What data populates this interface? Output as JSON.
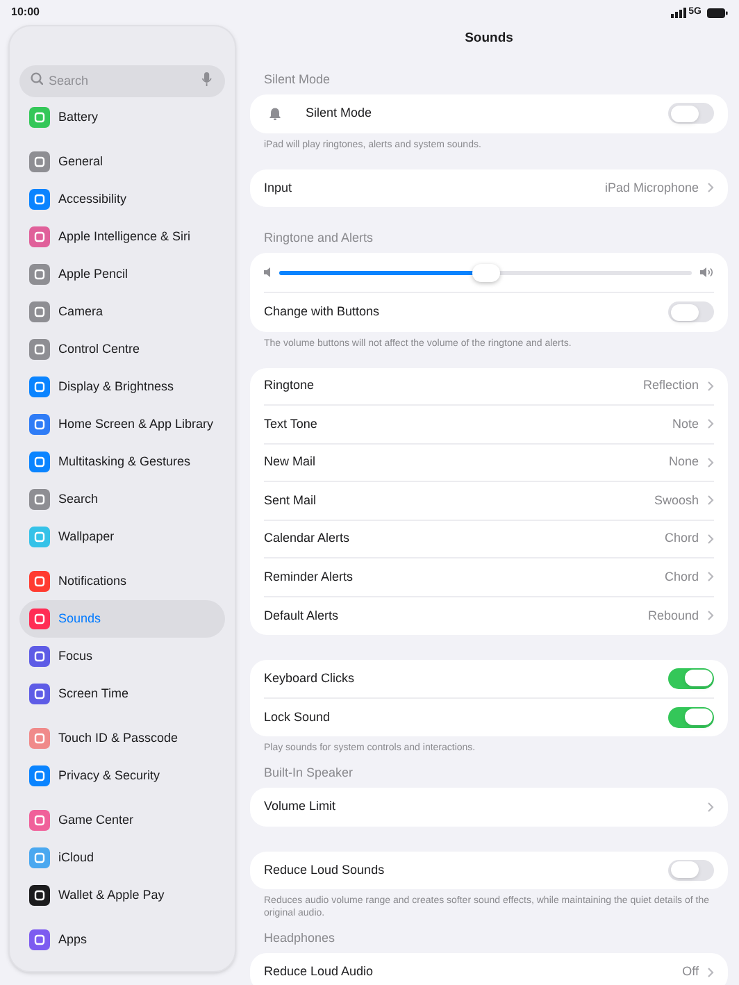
{
  "status_bar": {
    "time": "10:00",
    "network": "5G"
  },
  "sidebar": {
    "search": {
      "placeholder": "Search"
    },
    "groups": [
      {
        "items": [
          {
            "label": "Battery",
            "color": "#34c759",
            "selected": false
          }
        ]
      },
      {
        "items": [
          {
            "label": "General",
            "color": "#8e8e93",
            "selected": false
          },
          {
            "label": "Accessibility",
            "color": "#0a84ff",
            "selected": false
          },
          {
            "label": "Apple Intelligence & Siri",
            "color": "#e0609a",
            "selected": false
          },
          {
            "label": "Apple Pencil",
            "color": "#8e8e93",
            "selected": false
          },
          {
            "label": "Camera",
            "color": "#8e8e93",
            "selected": false
          },
          {
            "label": "Control Centre",
            "color": "#8e8e93",
            "selected": false
          },
          {
            "label": "Display & Brightness",
            "color": "#0a84ff",
            "selected": false
          },
          {
            "label": "Home Screen & App Library",
            "color": "#2f7cf6",
            "selected": false
          },
          {
            "label": "Multitasking & Gestures",
            "color": "#0a84ff",
            "selected": false
          },
          {
            "label": "Search",
            "color": "#8e8e93",
            "selected": false
          },
          {
            "label": "Wallpaper",
            "color": "#35c2e8",
            "selected": false
          }
        ]
      },
      {
        "items": [
          {
            "label": "Notifications",
            "color": "#ff3b30",
            "selected": false
          },
          {
            "label": "Sounds",
            "color": "#ff2d55",
            "selected": true
          },
          {
            "label": "Focus",
            "color": "#5e5ce6",
            "selected": false
          },
          {
            "label": "Screen Time",
            "color": "#5e5ce6",
            "selected": false
          }
        ]
      },
      {
        "items": [
          {
            "label": "Touch ID & Passcode",
            "color": "#f08a8a",
            "selected": false
          },
          {
            "label": "Privacy & Security",
            "color": "#0a84ff",
            "selected": false
          }
        ]
      },
      {
        "items": [
          {
            "label": "Game Center",
            "color": "#f0609a",
            "selected": false
          },
          {
            "label": "iCloud",
            "color": "#4aa8f0",
            "selected": false
          },
          {
            "label": "Wallet & Apple Pay",
            "color": "#1c1c1e",
            "selected": false
          }
        ]
      },
      {
        "items": [
          {
            "label": "Apps",
            "color": "#7d5cf0",
            "selected": false
          }
        ]
      }
    ]
  },
  "detail": {
    "title": "Sounds",
    "sections": [
      {
        "header": "Silent Mode",
        "rows": [
          {
            "kind": "icon-toggle",
            "label": "Silent Mode",
            "on": false
          }
        ],
        "footer": "iPad will play ringtones, alerts and system sounds."
      },
      {
        "rows": [
          {
            "kind": "link",
            "label": "Input",
            "value": "iPad Microphone"
          }
        ]
      },
      {
        "header": "Ringtone and Alerts",
        "rows": [
          {
            "kind": "slider",
            "level": 0.5
          },
          {
            "kind": "toggle",
            "label": "Change with Buttons",
            "on": false
          }
        ],
        "footer": "The volume buttons will not affect the volume of the ringtone and alerts."
      },
      {
        "rows": [
          {
            "kind": "link",
            "label": "Ringtone",
            "value": "Reflection"
          },
          {
            "kind": "link",
            "label": "Text Tone",
            "value": "Note"
          },
          {
            "kind": "link",
            "label": "New Mail",
            "value": "None"
          },
          {
            "kind": "link",
            "label": "Sent Mail",
            "value": "Swoosh"
          },
          {
            "kind": "link",
            "label": "Calendar Alerts",
            "value": "Chord"
          },
          {
            "kind": "link",
            "label": "Reminder Alerts",
            "value": "Chord"
          },
          {
            "kind": "link",
            "label": "Default Alerts",
            "value": "Rebound"
          }
        ]
      },
      {
        "rows": [
          {
            "kind": "toggle",
            "label": "Keyboard Clicks",
            "on": true
          },
          {
            "kind": "toggle",
            "label": "Lock Sound",
            "on": true
          }
        ],
        "footer": "Play sounds for system controls and interactions."
      },
      {
        "header": "Built-In Speaker",
        "rows": [
          {
            "kind": "link",
            "label": "Volume Limit"
          }
        ]
      },
      {
        "rows": [
          {
            "kind": "toggle",
            "label": "Reduce Loud Sounds",
            "on": false
          }
        ],
        "footer": "Reduces audio volume range and creates softer sound effects, while maintaining the quiet details of the original audio."
      },
      {
        "header": "Headphones",
        "rows": [
          {
            "kind": "link",
            "label": "Reduce Loud Audio",
            "value": "Off"
          }
        ]
      }
    ]
  }
}
